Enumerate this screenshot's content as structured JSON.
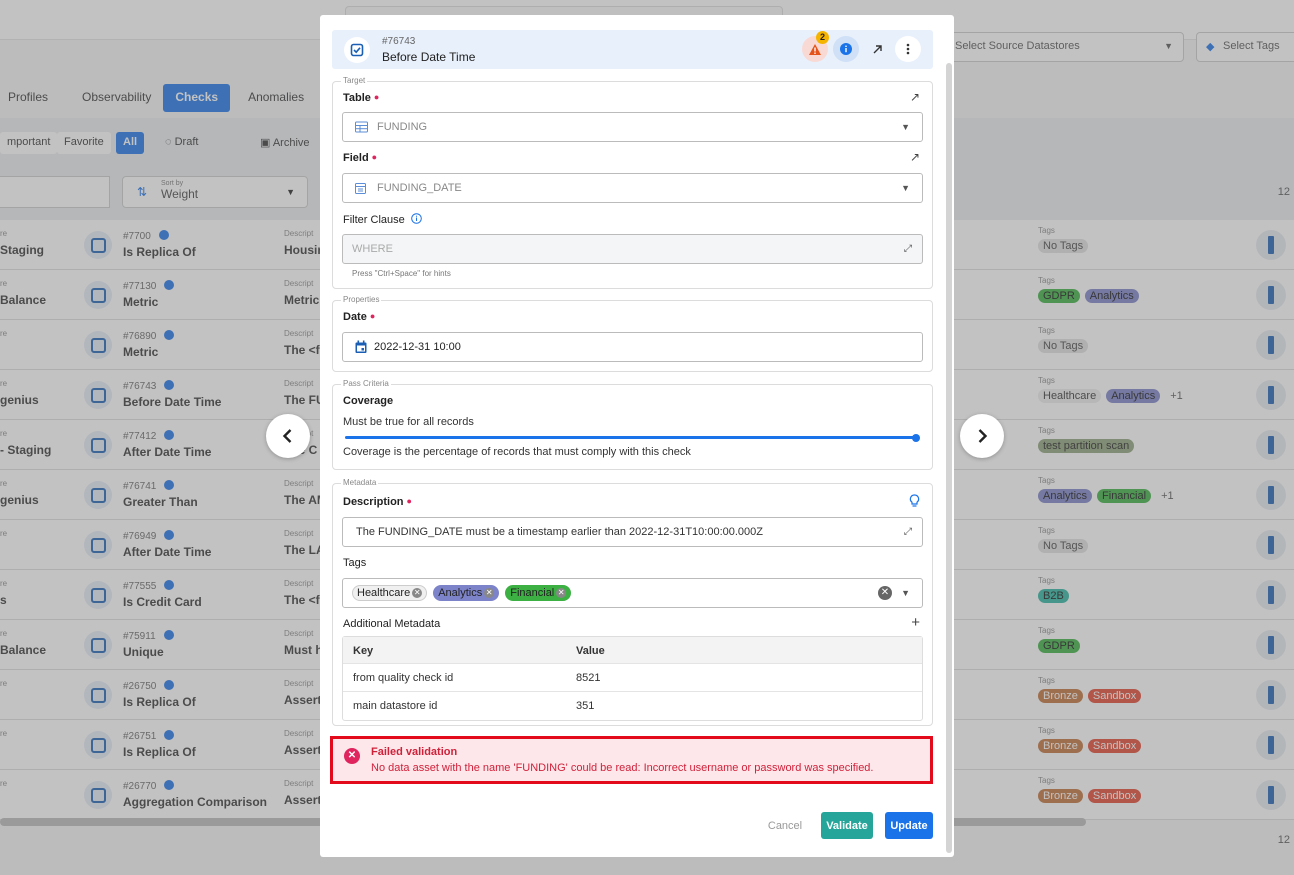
{
  "background": {
    "datastore_select_placeholder": "Select Source Datastores",
    "tags_select_placeholder": "Select Tags",
    "tabs": [
      "Profiles",
      "Observability",
      "Checks",
      "Anomalies"
    ],
    "filters": {
      "important": "mportant",
      "favorite": "Favorite",
      "all": "All",
      "draft": "Draft",
      "archived": "Archive"
    },
    "sort_by_label": "Sort by",
    "sort_by_value": "Weight",
    "count": "12",
    "row_label": "re",
    "desc_label": "Descript",
    "tags_label": "Tags",
    "rows": [
      {
        "datastore": "Staging",
        "id": "#7700",
        "name": "Is Replica Of",
        "desc": "Housin",
        "tags": [
          {
            "t": "No Tags",
            "c": "#e0e0e0",
            "fc": "#444"
          }
        ]
      },
      {
        "datastore": "Balance",
        "id": "#77130",
        "name": "Metric",
        "desc": "Metric",
        "tags": [
          {
            "t": "GDPR",
            "c": "#3cb043",
            "fc": "#111"
          },
          {
            "t": "Analytics",
            "c": "#7c83c9",
            "fc": "#111"
          }
        ]
      },
      {
        "datastore": "",
        "id": "#76890",
        "name": "Metric",
        "desc": "The <fi",
        "tags": [
          {
            "t": "No Tags",
            "c": "#e0e0e0",
            "fc": "#444"
          }
        ]
      },
      {
        "datastore": "genius",
        "id": "#76743",
        "name": "Before Date Time",
        "desc": "The FUI",
        "tags": [
          {
            "t": "Healthcare",
            "c": "#ececec",
            "fc": "#333"
          },
          {
            "t": "Analytics",
            "c": "#7c83c9",
            "fc": "#111"
          },
          {
            "t": "+1",
            "c": "transparent",
            "fc": "#555"
          }
        ]
      },
      {
        "datastore": "- Staging",
        "id": "#77412",
        "name": "After Date Time",
        "desc": "The C",
        "tags": [
          {
            "t": "test partition scan",
            "c": "#8ea37a",
            "fc": "#222"
          }
        ]
      },
      {
        "datastore": "genius",
        "id": "#76741",
        "name": "Greater Than",
        "desc": "The AM",
        "tags": [
          {
            "t": "Analytics",
            "c": "#7c83c9",
            "fc": "#111"
          },
          {
            "t": "Financial",
            "c": "#3cb043",
            "fc": "#111"
          },
          {
            "t": "+1",
            "c": "transparent",
            "fc": "#555"
          }
        ]
      },
      {
        "datastore": "",
        "id": "#76949",
        "name": "After Date Time",
        "desc": "The LAS",
        "tags": [
          {
            "t": "No Tags",
            "c": "#e0e0e0",
            "fc": "#444"
          }
        ]
      },
      {
        "datastore": "s",
        "id": "#77555",
        "name": "Is Credit Card",
        "desc": "The <fi",
        "tags": [
          {
            "t": "B2B",
            "c": "#2bb3a0",
            "fc": "#111"
          }
        ]
      },
      {
        "datastore": "Balance",
        "id": "#75911",
        "name": "Unique",
        "desc": "Must ha",
        "tags": [
          {
            "t": "GDPR",
            "c": "#3cb043",
            "fc": "#111"
          }
        ]
      },
      {
        "datastore": "",
        "id": "#26750",
        "name": "Is Replica Of",
        "desc": "Asserts",
        "tags": [
          {
            "t": "Bronze",
            "c": "#c0703a",
            "fc": "#fff"
          },
          {
            "t": "Sandbox",
            "c": "#e2452f",
            "fc": "#fff"
          }
        ]
      },
      {
        "datastore": "",
        "id": "#26751",
        "name": "Is Replica Of",
        "desc": "Assert t",
        "tags": [
          {
            "t": "Bronze",
            "c": "#c0703a",
            "fc": "#fff"
          },
          {
            "t": "Sandbox",
            "c": "#e2452f",
            "fc": "#fff"
          }
        ]
      },
      {
        "datastore": "",
        "id": "#26770",
        "name": "Aggregation Comparison",
        "desc": "Asserts",
        "tags": [
          {
            "t": "Bronze",
            "c": "#c0703a",
            "fc": "#fff"
          },
          {
            "t": "Sandbox",
            "c": "#e2452f",
            "fc": "#fff"
          }
        ]
      }
    ]
  },
  "modal": {
    "header": {
      "id": "#76743",
      "title": "Before Date Time",
      "alert_count": "2"
    },
    "target": {
      "legend": "Target",
      "table_label": "Table",
      "table_value": "FUNDING",
      "field_label": "Field",
      "field_value": "FUNDING_DATE",
      "filter_label": "Filter Clause",
      "filter_placeholder": "WHERE",
      "filter_hint": "Press \"Ctrl+Space\" for hints"
    },
    "properties": {
      "legend": "Properties",
      "date_label": "Date",
      "date_value": "2022-12-31 10:00"
    },
    "pass_criteria": {
      "legend": "Pass Criteria",
      "coverage_label": "Coverage",
      "coverage_text": "Must be true for all records",
      "coverage_fraction": 1.0,
      "coverage_help": "Coverage is the percentage of records that must comply with this check"
    },
    "metadata": {
      "legend": "Metadata",
      "description_label": "Description",
      "description_value": "The FUNDING_DATE must be a timestamp earlier than 2022-12-31T10:00:00.000Z",
      "tags_label": "Tags",
      "tags": [
        {
          "label": "Healthcare",
          "color": "#f0f0f0"
        },
        {
          "label": "Analytics",
          "color": "#7c83c9"
        },
        {
          "label": "Financial",
          "color": "#3cb043"
        }
      ],
      "additional_label": "Additional Metadata",
      "table_headers": {
        "key": "Key",
        "value": "Value"
      },
      "rows": [
        {
          "key": "from quality check id",
          "value": "8521"
        },
        {
          "key": "main datastore id",
          "value": "351"
        }
      ]
    },
    "error": {
      "title": "Failed validation",
      "message": "No data asset with the name 'FUNDING' could be read: Incorrect username or password was specified."
    },
    "buttons": {
      "cancel": "Cancel",
      "validate": "Validate",
      "update": "Update"
    }
  },
  "colors": {
    "primary": "#1a73e8",
    "validate": "#26a69a",
    "error": "#e20a1b"
  }
}
